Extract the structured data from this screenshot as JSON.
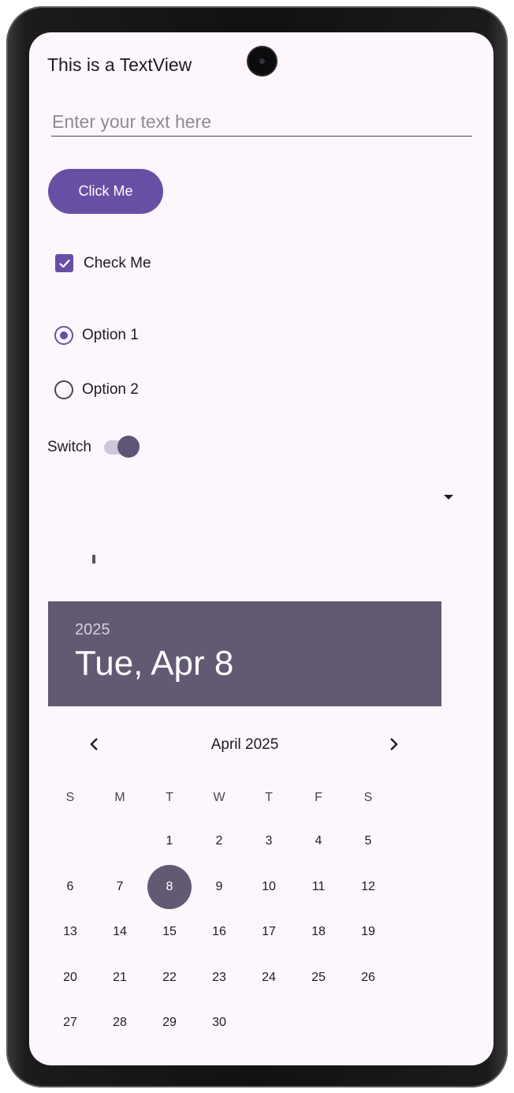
{
  "textview": {
    "text": "This is a TextView"
  },
  "edittext": {
    "placeholder": "Enter your text here"
  },
  "button": {
    "label": "Click Me"
  },
  "checkbox": {
    "label": "Check Me",
    "checked": true
  },
  "radio": {
    "options": [
      {
        "label": "Option 1",
        "selected": true
      },
      {
        "label": "Option 2",
        "selected": false
      }
    ]
  },
  "switch": {
    "label": "Switch",
    "on": true
  },
  "colors": {
    "primary": "#6750a4",
    "header": "#625a72",
    "background": "#fdf7fd"
  },
  "datepicker": {
    "year": "2025",
    "date_label": "Tue, Apr 8",
    "month_label": "April 2025",
    "prev_icon": "chevron-left-icon",
    "next_icon": "chevron-right-icon",
    "weekdays": [
      "S",
      "M",
      "T",
      "W",
      "T",
      "F",
      "S"
    ],
    "weeks": [
      [
        "",
        "",
        "1",
        "2",
        "3",
        "4",
        "5"
      ],
      [
        "6",
        "7",
        "8",
        "9",
        "10",
        "11",
        "12"
      ],
      [
        "13",
        "14",
        "15",
        "16",
        "17",
        "18",
        "19"
      ],
      [
        "20",
        "21",
        "22",
        "23",
        "24",
        "25",
        "26"
      ],
      [
        "27",
        "28",
        "29",
        "30",
        "",
        "",
        ""
      ]
    ],
    "selected_day": "8"
  }
}
